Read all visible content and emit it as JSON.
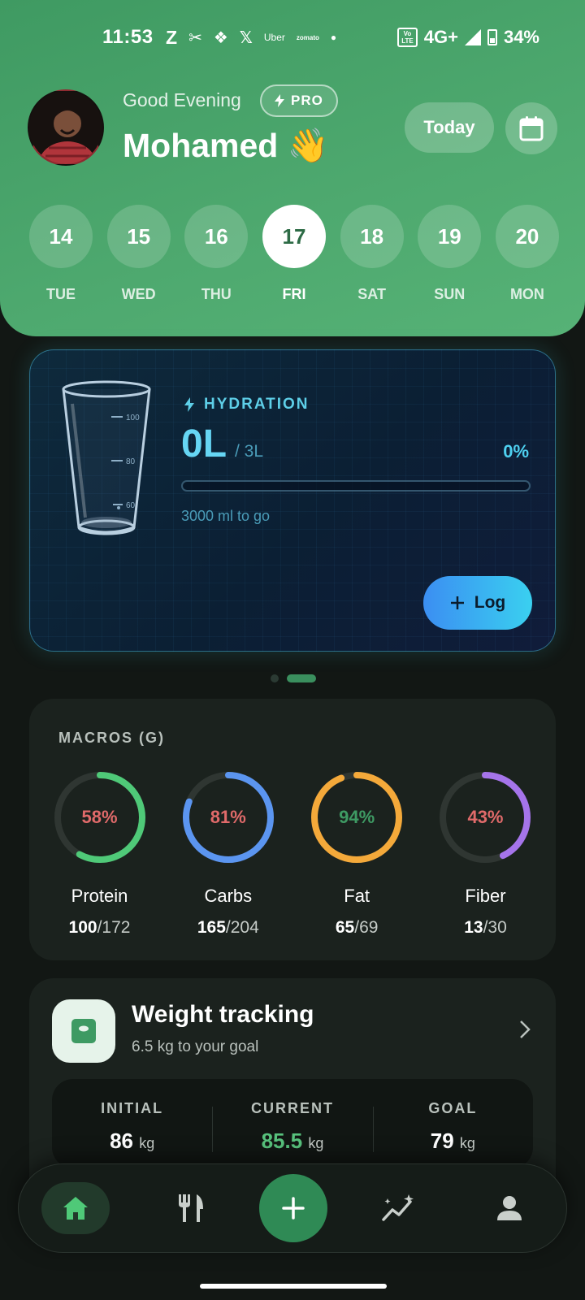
{
  "status_bar": {
    "time": "11:53",
    "apps": [
      "Z",
      "Uber",
      "zomato"
    ],
    "volte": "Vo LTE",
    "network": "4G+",
    "battery": "34%"
  },
  "header": {
    "greeting": "Good Evening",
    "pro_badge": "PRO",
    "user_name": "Mohamed 👋",
    "today_button": "Today"
  },
  "days": [
    {
      "num": "14",
      "label": "TUE"
    },
    {
      "num": "15",
      "label": "WED"
    },
    {
      "num": "16",
      "label": "THU"
    },
    {
      "num": "17",
      "label": "FRI",
      "active": true
    },
    {
      "num": "18",
      "label": "SAT"
    },
    {
      "num": "19",
      "label": "SUN"
    },
    {
      "num": "20",
      "label": "MON"
    }
  ],
  "hydration": {
    "title": "HYDRATION",
    "value": "0L",
    "total": "/ 3L",
    "percent": "0%",
    "progress": 0,
    "remaining": "3000 ml to go",
    "glass_marks": [
      "100",
      "80",
      "60"
    ],
    "log_button": "Log"
  },
  "macros": {
    "title": "MACROS (G)",
    "items": [
      {
        "name": "Protein",
        "percent_label": "58%",
        "percent": 58,
        "eaten": "100",
        "target": "/172",
        "color": "#4fc978",
        "pct_color": "#e06a6a"
      },
      {
        "name": "Carbs",
        "percent_label": "81%",
        "percent": 81,
        "eaten": "165",
        "target": "/204",
        "color": "#5b95f0",
        "pct_color": "#e06a6a"
      },
      {
        "name": "Fat",
        "percent_label": "94%",
        "percent": 94,
        "eaten": "65",
        "target": "/69",
        "color": "#f4a93a",
        "pct_color": "#3e9a63"
      },
      {
        "name": "Fiber",
        "percent_label": "43%",
        "percent": 43,
        "eaten": "13",
        "target": "/30",
        "color": "#a574ea",
        "pct_color": "#e06a6a"
      }
    ]
  },
  "weight": {
    "title": "Weight tracking",
    "subtitle": "6.5 kg to your goal",
    "initial_label": "INITIAL",
    "initial_value": "86",
    "current_label": "CURRENT",
    "current_value": "85.5",
    "goal_label": "GOAL",
    "goal_value": "79",
    "unit": "kg"
  },
  "colors": {
    "header_green": "#4ea96f",
    "accent_cyan": "#4ed0f0",
    "nav_add": "#2f8a55"
  }
}
